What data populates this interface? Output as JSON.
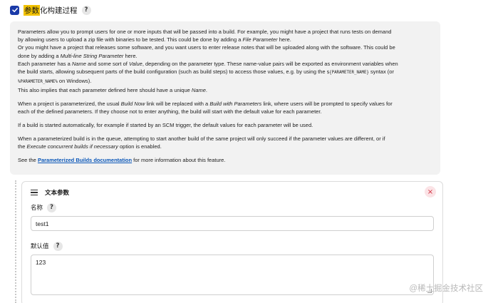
{
  "header": {
    "title_highlight": "参数",
    "title_rest": "化构建过程",
    "help": "?"
  },
  "help": {
    "p1": {
      "l1": "Parameters allow you to prompt users for one or more inputs that will be passed into a build. For example, you might have a project that runs tests on demand",
      "l2a": "by allowing users to upload a zip file with binaries to be tested. This could be done by adding a ",
      "l2em": "File Parameter",
      "l2b": " here.",
      "l3": "Or you might have a project that releases some software, and you want users to enter release notes that will be uploaded along with the software. This could be",
      "l4a": "done by adding a ",
      "l4em": "Multi-line String Parameter",
      "l4b": " here.",
      "l5a": "Each parameter has a ",
      "l5em1": "Name",
      "l5b": " and some sort of ",
      "l5em2": "Value",
      "l5c": ", depending on the parameter type. These name-value pairs will be exported as environment variables when",
      "l6a": "the build starts, allowing subsequent parts of the build configuration (such as build steps) to access those values, e.g. by using the ",
      "l6code": "${PARAMETER_NAME}",
      "l6b": " syntax (or",
      "l7code": "%PARAMETER_NAME%",
      "l7b": " on Windows).",
      "l8a": "This also implies that each parameter defined here should have a unique ",
      "l8em": "Name",
      "l8b": "."
    },
    "p2": {
      "l1a": "When a project is parameterized, the usual ",
      "l1em1": "Build Now",
      "l1b": " link will be replaced with a ",
      "l1em2": "Build with Parameters",
      "l1c": " link, where users will be prompted to specify values for",
      "l2": "each of the defined parameters. If they choose not to enter anything, the build will start with the default value for each parameter."
    },
    "p3": "If a build is started automatically, for example if started by an SCM trigger, the default values for each parameter will be used.",
    "p4": {
      "l1": "When a parameterized build is in the queue, attempting to start another build of the same project will only succeed if the parameter values are different, or if",
      "l2a": "the ",
      "l2em": "Execute concurrent builds if necessary",
      "l2b": " option is enabled."
    },
    "p5": {
      "a": "See the ",
      "link": "Parameterized Builds documentation",
      "b": " for more information about this feature."
    }
  },
  "card": {
    "title": "文本参数",
    "close": "×",
    "name_label": "名称",
    "name_value": "test1",
    "default_label": "默认值",
    "default_value": "123",
    "help": "?"
  },
  "watermark": "@稀土掘金技术社区"
}
